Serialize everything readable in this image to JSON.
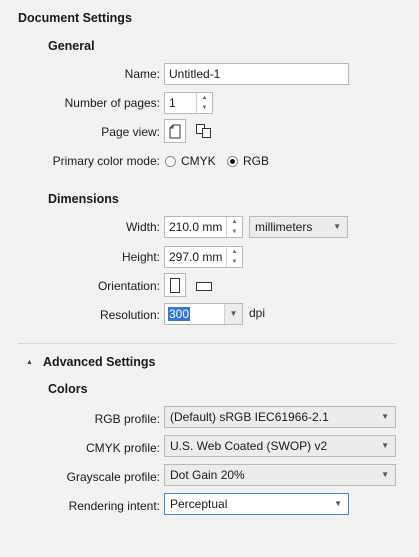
{
  "title": "Document Settings",
  "general": {
    "heading": "General",
    "name_label": "Name:",
    "name_value": "Untitled-1",
    "pages_label": "Number of pages:",
    "pages_value": "1",
    "page_view_label": "Page view:",
    "color_mode_label": "Primary color mode:",
    "color_modes": [
      {
        "label": "CMYK",
        "selected": false
      },
      {
        "label": "RGB",
        "selected": true
      }
    ]
  },
  "dimensions": {
    "heading": "Dimensions",
    "width_label": "Width:",
    "width_value": "210.0 mm",
    "units_value": "millimeters",
    "height_label": "Height:",
    "height_value": "297.0 mm",
    "orientation_label": "Orientation:",
    "resolution_label": "Resolution:",
    "resolution_value": "300",
    "resolution_unit": "dpi"
  },
  "advanced": {
    "heading": "Advanced Settings",
    "colors_heading": "Colors",
    "rgb_label": "RGB profile:",
    "rgb_value": "(Default) sRGB IEC61966-2.1",
    "cmyk_label": "CMYK profile:",
    "cmyk_value": "U.S. Web Coated (SWOP) v2",
    "gray_label": "Grayscale profile:",
    "gray_value": "Dot Gain 20%",
    "intent_label": "Rendering intent:",
    "intent_value": "Perceptual"
  },
  "colors": {
    "selection": "#3277d6",
    "focus_border": "#3c8dde"
  }
}
